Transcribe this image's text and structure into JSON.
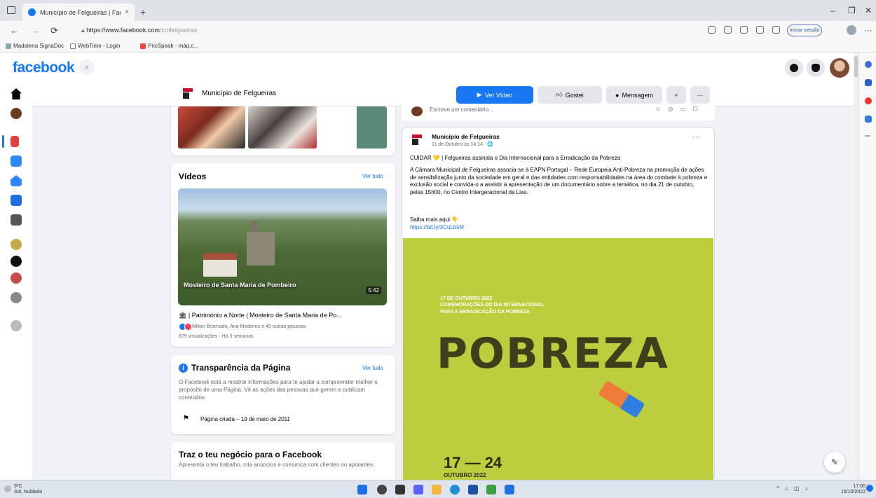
{
  "browser": {
    "tab_title": "Município de Felgueiras | Faceb",
    "tab_close": "×",
    "new_tab": "+",
    "url_host": "https://www.facebook.com",
    "url_path": "/cmfelgueiras",
    "signin_label": "Iniciar sessão",
    "more": "···",
    "minimize": "–",
    "restore": "❐",
    "close": "✕",
    "bookmarks": [
      {
        "label": "Madalena SignaDoc"
      },
      {
        "label": "WebTime - Login"
      },
      {
        "label": "PricSpeak - máq.c..."
      }
    ]
  },
  "facebook": {
    "logo": "facebook",
    "search_icon": "⌕"
  },
  "page_header": {
    "name": "Município de Felgueiras",
    "watch_video": "Ver Vídeo",
    "like": "Gostei",
    "message": "Mensagem",
    "search": "⌕",
    "more": "···"
  },
  "videos": {
    "title": "Vídeos",
    "see_all": "Ver tudo",
    "thumb_caption": "Mosteiro de Santa Maria de Pombeiro",
    "duration": "5:42",
    "video_title": "🏛 | Património a Norte | Mosteiro de Santa Maria de Po...",
    "reactions_text": "Milton Brochado, Ana Medeiros e 45 outras pessoas",
    "views": "879 visualizações · Há 3 semanas"
  },
  "transparency": {
    "title": "Transparência da Página",
    "see_all": "Ver tudo",
    "description": "O Facebook está a mostrar informações para te ajudar a compreender melhor o propósito de uma Página. Vê as ações das pessoas que gerem e publicam conteúdos.",
    "created": "Página criada – 19 de maio de 2011"
  },
  "business": {
    "title": "Traz o teu negócio para o Facebook",
    "description": "Apresenta o teu trabalho, cria anúncios e comunica com clientes ou apoiantes."
  },
  "comment_bar": {
    "placeholder": "Escreve um comentário..."
  },
  "post": {
    "author": "Município de Felgueiras",
    "date": "11 de Outubro às 14:14 · 🌐",
    "options": "···",
    "headline": "CUIDAR 💛 | Felgueiras assinala o Dia Internacional para a Erradicação da Pobreza",
    "body": "A Câmara Municipal de Felgueiras associa-se à EAPN Portugal – Rede Europeia Anti-Pobreza na promoção de ações de sensibilização junto da sociedade em geral e das entidades com responsabilidades na área do combate à pobreza e exclusão social e convida-o a assistir à apresentação de um documentário sobre a temática, no dia 21 de outubro, pelas 15h00, no Centro Intergeracional da Lixa.",
    "more_label": "Saiba mais aqui 👇",
    "link": "https://bit.ly/3CuLbsM",
    "poster": {
      "date_line1": "17 DE OUTUBRO 2022",
      "date_line2": "COMEMORAÇÕES DO DIA INTERNACIONAL",
      "date_line3": "PARA A ERRADICAÇÃO DA POBREZA",
      "big_word": "POBREZA",
      "range": "17 — 24",
      "range_sub": "OUTUBRO 2022"
    }
  },
  "fab_icon": "✎",
  "taskbar": {
    "weather_temp": "9ºC",
    "weather_desc": "Sol, Nublado",
    "time": "17:00",
    "date": "16/10/2022"
  },
  "colors": {
    "fb_blue": "#1877f2",
    "poster_bg": "#bccd3e"
  }
}
